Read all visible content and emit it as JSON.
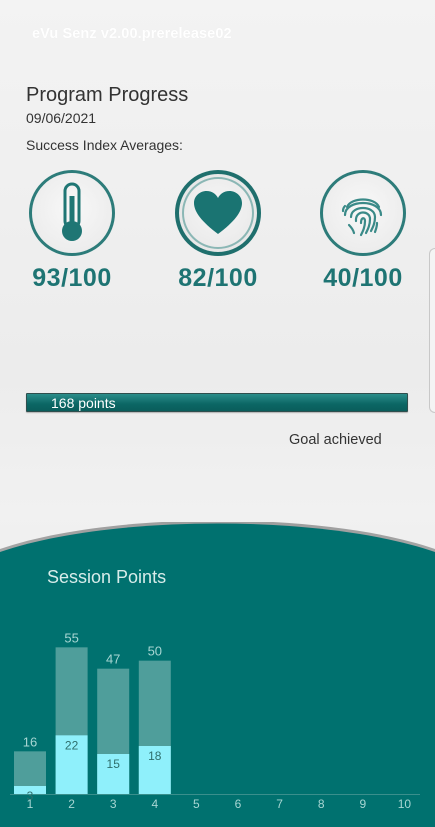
{
  "app": {
    "title": "eVu Senz v2.00.prerelease02"
  },
  "header": {
    "title": "Program Progress",
    "date": "09/06/2021",
    "section_label": "Success Index Averages:"
  },
  "metrics": [
    {
      "icon": "thermometer-icon",
      "value": "93/100"
    },
    {
      "icon": "heart-icon",
      "value": "82/100"
    },
    {
      "icon": "fingerprint-icon",
      "value": "40/100"
    }
  ],
  "progress": {
    "label": "168 points",
    "fraction": 1.0,
    "status": "Goal achieved"
  },
  "colors": {
    "teal": "#00716f",
    "teal_text": "#1e7473",
    "bar_dark": "#4f9e9b",
    "bar_light": "#8ff0fb",
    "label_light": "#a7d6d3",
    "label_dark": "#2e6f6c"
  },
  "chart_data": {
    "type": "bar",
    "title": "Session Points",
    "categories": [
      "1",
      "2",
      "3",
      "4",
      "5",
      "6",
      "7",
      "8",
      "9",
      "10"
    ],
    "ylim": [
      0,
      60
    ],
    "series": [
      {
        "values": [
          16,
          55,
          47,
          50,
          null,
          null,
          null,
          null,
          null,
          null
        ]
      },
      {
        "values": [
          3,
          22,
          15,
          18,
          null,
          null,
          null,
          null,
          null,
          null
        ]
      }
    ]
  }
}
